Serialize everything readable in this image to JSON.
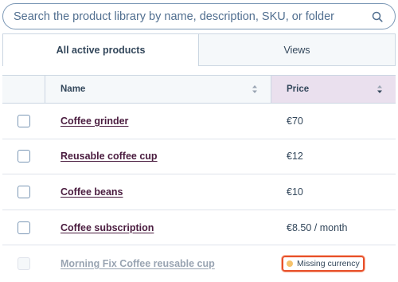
{
  "search": {
    "placeholder": "Search the product library by name, description, SKU, or folder"
  },
  "tabs": [
    {
      "label": "All active products"
    },
    {
      "label": "Views"
    }
  ],
  "table": {
    "columns": {
      "name": "Name",
      "price": "Price"
    },
    "rows": [
      {
        "name": "Coffee grinder",
        "price": "€70"
      },
      {
        "name": "Reusable coffee cup",
        "price": "€12"
      },
      {
        "name": "Coffee beans",
        "price": "€10"
      },
      {
        "name": "Coffee subscription",
        "price": "€8.50 / month"
      },
      {
        "name": "Morning Fix Coffee reusable cup",
        "price": "Missing currency"
      }
    ]
  },
  "colors": {
    "accent": "#e8502a",
    "warning_dot": "#f5c26b",
    "link": "#4a1c3f"
  }
}
